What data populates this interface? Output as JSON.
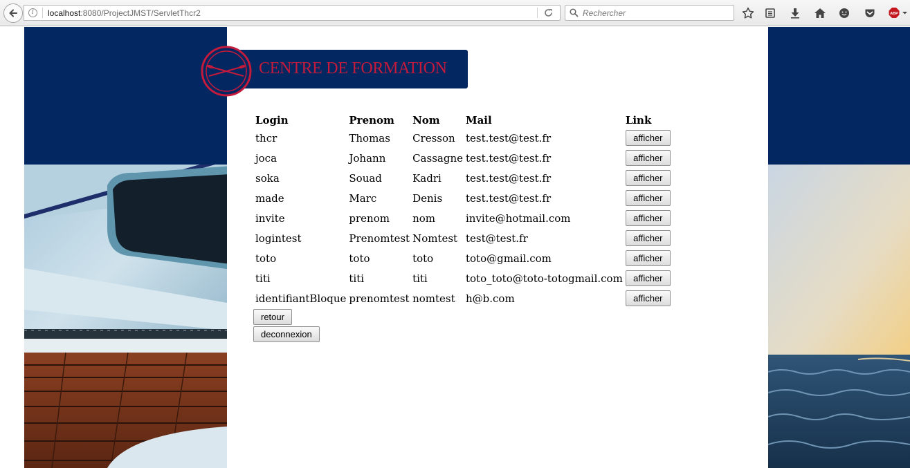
{
  "browser": {
    "url_host": "localhost",
    "url_rest": ":8080/ProjectJMST/ServletThcr2",
    "search_placeholder": "Rechercher",
    "abp_label": "ABP"
  },
  "page": {
    "banner_title": "CENTRE DE FORMATION",
    "colors": {
      "navy": "#022761",
      "brand_red": "#c41a3c"
    }
  },
  "table": {
    "headers": [
      "Login",
      "Prenom",
      "Nom",
      "Mail",
      "Link"
    ],
    "rows": [
      {
        "login": "thcr",
        "prenom": "Thomas",
        "nom": "Cresson",
        "mail": "test.test@test.fr",
        "link": "afficher"
      },
      {
        "login": "joca",
        "prenom": "Johann",
        "nom": "Cassagne",
        "mail": "test.test@test.fr",
        "link": "afficher"
      },
      {
        "login": "soka",
        "prenom": "Souad",
        "nom": "Kadri",
        "mail": "test.test@test.fr",
        "link": "afficher"
      },
      {
        "login": "made",
        "prenom": "Marc",
        "nom": "Denis",
        "mail": "test.test@test.fr",
        "link": "afficher"
      },
      {
        "login": "invite",
        "prenom": "prenom",
        "nom": "nom",
        "mail": "invite@hotmail.com",
        "link": "afficher"
      },
      {
        "login": "logintest",
        "prenom": "Prenomtest",
        "nom": "Nomtest",
        "mail": "test@test.fr",
        "link": "afficher"
      },
      {
        "login": "toto",
        "prenom": "toto",
        "nom": "toto",
        "mail": "toto@gmail.com",
        "link": "afficher"
      },
      {
        "login": "titi",
        "prenom": "titi",
        "nom": "titi",
        "mail": "toto_toto@toto-totogmail.com",
        "link": "afficher"
      },
      {
        "login": "identifiantBloque",
        "prenom": "prenomtest",
        "nom": "nomtest",
        "mail": "h@b.com",
        "link": "afficher"
      }
    ]
  },
  "actions": {
    "retour": "retour",
    "deconnexion": "deconnexion"
  }
}
